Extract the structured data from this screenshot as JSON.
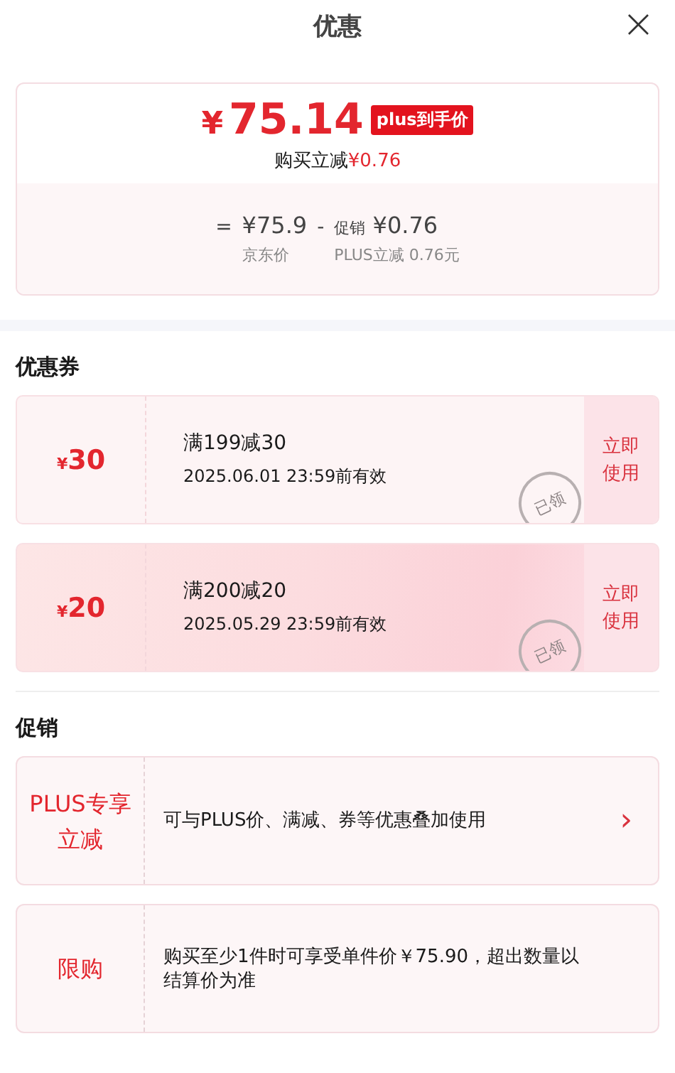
{
  "header": {
    "title": "优惠",
    "close": "×"
  },
  "price_card": {
    "currency": "¥",
    "price": "75.14",
    "badge": "plus到手价",
    "saving_label": "购买立减",
    "saving_value": "¥0.76",
    "formula": {
      "equals": "=",
      "base_price": "¥75.9",
      "minus": "-",
      "promo_label": "促销",
      "promo_value": "¥0.76",
      "base_caption": "京东价",
      "promo_caption": "PLUS立减 0.76元"
    }
  },
  "coupons": {
    "title": "优惠券",
    "items": [
      {
        "kind": "plain",
        "currency": "¥",
        "amount": "30",
        "condition": "满199减30",
        "validity": "2025.06.01 23:59前有效",
        "stamp": "已领",
        "action": "立即使用"
      },
      {
        "kind": "gradient",
        "currency": "¥",
        "amount": "20",
        "condition": "满200减20",
        "validity": "2025.05.29 23:59前有效",
        "stamp": "已领",
        "action": "立即使用"
      }
    ]
  },
  "promotions": {
    "title": "促销",
    "items": [
      {
        "label": "PLUS专享立减",
        "text": "可与PLUS价、满减、券等优惠叠加使用",
        "chevron": "›"
      },
      {
        "label": "限购",
        "text": "购买至少1件时可享受单件价￥75.90，超出数量以结算价为准"
      }
    ]
  }
}
